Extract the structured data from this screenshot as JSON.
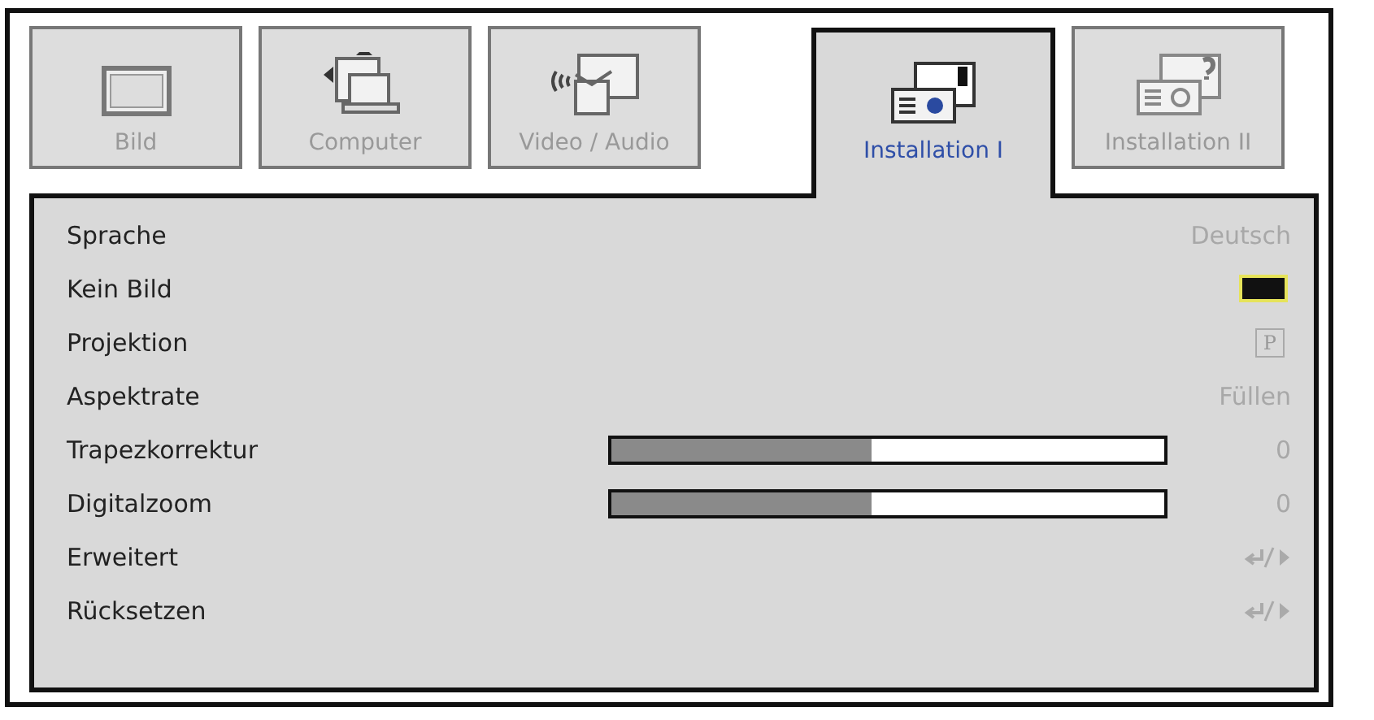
{
  "tabs": [
    {
      "label": "Bild",
      "selected": false
    },
    {
      "label": "Computer",
      "selected": false
    },
    {
      "label": "Video / Audio",
      "selected": false
    },
    {
      "label": "Installation I",
      "selected": true
    },
    {
      "label": "Installation II",
      "selected": false
    }
  ],
  "rows": [
    {
      "kind": "text",
      "label": "Sprache",
      "value": "Deutsch"
    },
    {
      "kind": "swatch",
      "label": "Kein Bild"
    },
    {
      "kind": "boxed",
      "label": "Projektion",
      "value": "P"
    },
    {
      "kind": "text",
      "label": "Aspektrate",
      "value": "Füllen"
    },
    {
      "kind": "slider",
      "label": "Trapezkorrektur",
      "level": 0.47,
      "reading": "0"
    },
    {
      "kind": "slider",
      "label": "Digitalzoom",
      "level": 0.47,
      "reading": "0"
    },
    {
      "kind": "submenu",
      "label": "Erweitert"
    },
    {
      "kind": "submenu",
      "label": "Rücksetzen"
    }
  ]
}
